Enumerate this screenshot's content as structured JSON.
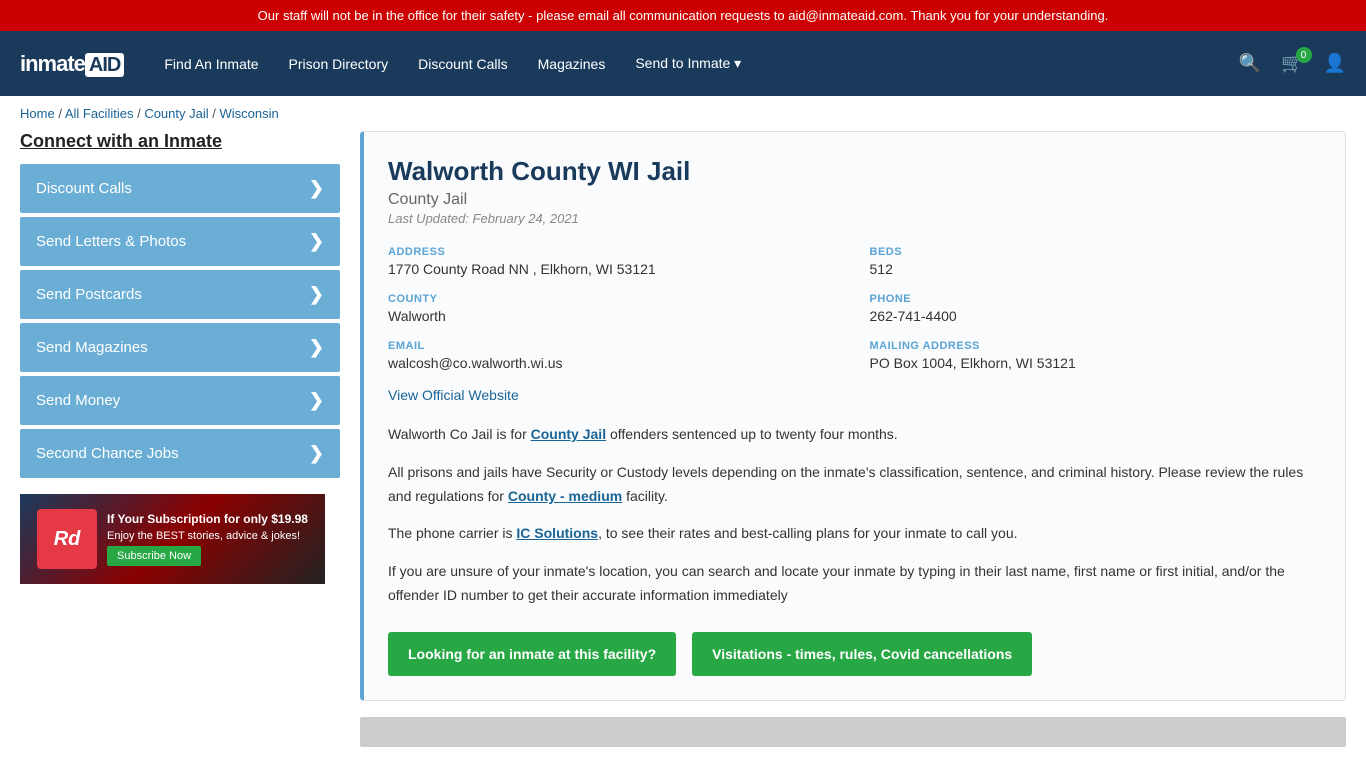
{
  "alert": {
    "text": "Our staff will not be in the office for their safety - please email all communication requests to aid@inmateaid.com. Thank you for your understanding."
  },
  "nav": {
    "logo": "inmate",
    "logo_aid": "AID",
    "links": [
      {
        "label": "Find An Inmate",
        "id": "find-an-inmate"
      },
      {
        "label": "Prison Directory",
        "id": "prison-directory"
      },
      {
        "label": "Discount Calls",
        "id": "discount-calls"
      },
      {
        "label": "Magazines",
        "id": "magazines"
      },
      {
        "label": "Send to Inmate ▾",
        "id": "send-to-inmate"
      }
    ],
    "cart_count": "0"
  },
  "breadcrumb": {
    "items": [
      "Home",
      "All Facilities",
      "County Jail",
      "Wisconsin"
    ]
  },
  "sidebar": {
    "title": "Connect with an Inmate",
    "buttons": [
      {
        "label": "Discount Calls",
        "id": "discount-calls-btn"
      },
      {
        "label": "Send Letters & Photos",
        "id": "send-letters-btn"
      },
      {
        "label": "Send Postcards",
        "id": "send-postcards-btn"
      },
      {
        "label": "Send Magazines",
        "id": "send-magazines-btn"
      },
      {
        "label": "Send Money",
        "id": "send-money-btn"
      },
      {
        "label": "Second Chance Jobs",
        "id": "second-chance-btn"
      }
    ]
  },
  "ad": {
    "logo": "Rd",
    "headline": "If Your Subscription for only $19.98",
    "subtext": "Enjoy the BEST stories, advice & jokes!",
    "button": "Subscribe Now"
  },
  "facility": {
    "title": "Walworth County WI Jail",
    "type": "County Jail",
    "updated": "Last Updated: February 24, 2021",
    "address_label": "ADDRESS",
    "address_value": "1770 County Road NN , Elkhorn, WI 53121",
    "beds_label": "BEDS",
    "beds_value": "512",
    "county_label": "COUNTY",
    "county_value": "Walworth",
    "phone_label": "PHONE",
    "phone_value": "262-741-4400",
    "email_label": "EMAIL",
    "email_value": "walcosh@co.walworth.wi.us",
    "mailing_label": "MAILING ADDRESS",
    "mailing_value": "PO Box 1004, Elkhorn, WI 53121",
    "website_label": "View Official Website",
    "desc1": "Walworth Co Jail is for County Jail offenders sentenced up to twenty four months.",
    "desc2": "All prisons and jails have Security or Custody levels depending on the inmate's classification, sentence, and criminal history. Please review the rules and regulations for County - medium facility.",
    "desc3": "The phone carrier is IC Solutions, to see their rates and best-calling plans for your inmate to call you.",
    "desc4": "If you are unsure of your inmate's location, you can search and locate your inmate by typing in their last name, first name or first initial, and/or the offender ID number to get their accurate information immediately",
    "btn_inmate": "Looking for an inmate at this facility?",
    "btn_visit": "Visitations - times, rules, Covid cancellations"
  }
}
